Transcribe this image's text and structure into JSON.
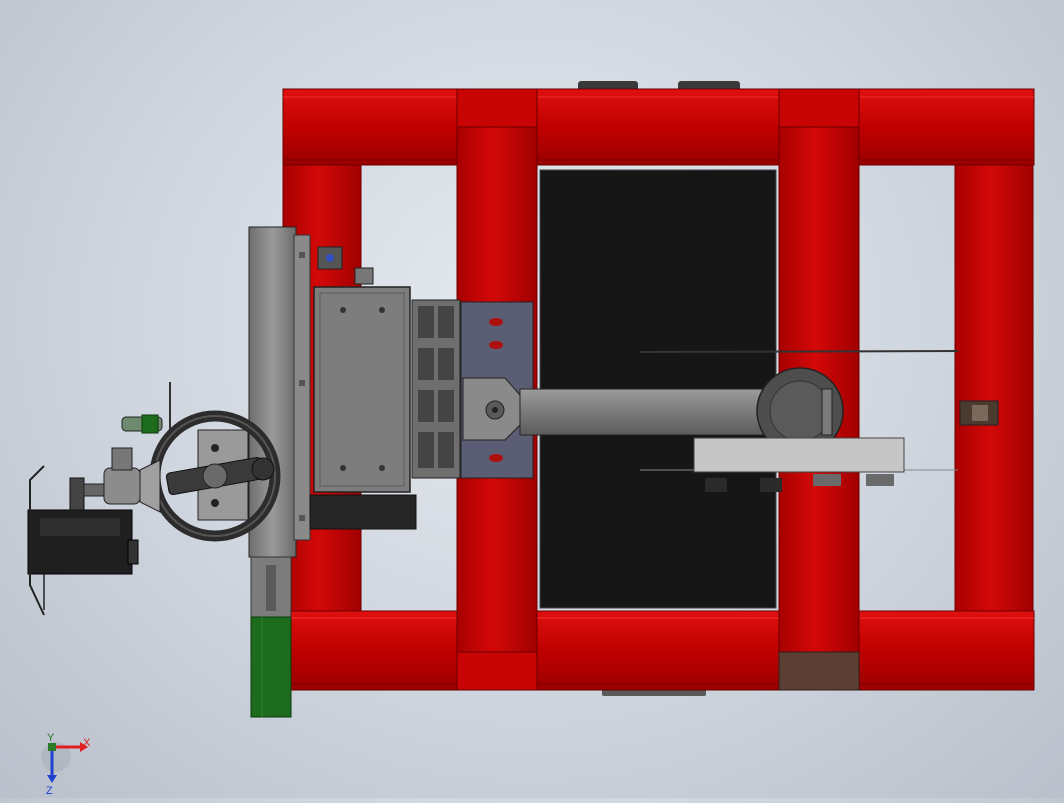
{
  "viewport": {
    "background_color": "#c9d0da",
    "frame_color": "#c40000",
    "frame_shadow_color": "#8a0000",
    "panel_color": "#161616",
    "steel_color": "#8c8c8c",
    "rail_color": "#1d6b1d",
    "pad_color": "#5b3f34"
  },
  "triad": {
    "x_label": "X",
    "y_label": "Y",
    "z_label": "Z",
    "x_color": "#e02020",
    "y_color": "#2a7a2a",
    "z_color": "#2040d0"
  }
}
